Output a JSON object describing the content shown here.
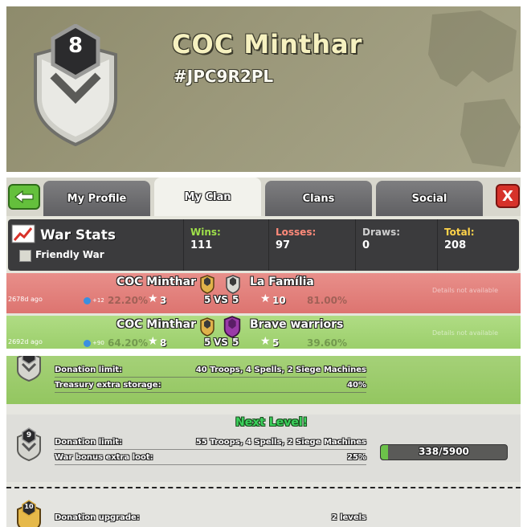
{
  "header": {
    "clan_level": "8",
    "clan_name": "COC Minthar",
    "clan_tag": "#JPC9R2PL"
  },
  "tabs": [
    "My Profile",
    "My Clan",
    "Clans",
    "Social"
  ],
  "active_tab": "My Clan",
  "close_label": "X",
  "war_stats": {
    "title": "War Stats",
    "friendly_war_label": "Friendly War",
    "wins_label": "Wins:",
    "wins": "111",
    "losses_label": "Losses:",
    "losses": "97",
    "draws_label": "Draws:",
    "draws": "0",
    "total_label": "Total:",
    "total": "208"
  },
  "war_log": [
    {
      "ago": "2678d ago",
      "our_name": "COC Minthar",
      "our_level": "8",
      "opponent": "La Família",
      "opponent_level": "9",
      "xp": "+12",
      "our_pct": "22.20%",
      "our_stars": "3",
      "our_size": "5",
      "vs": "VS",
      "opp_size": "5",
      "opp_stars": "10",
      "opp_pct": "81.00%",
      "details": "Details not available",
      "result": "loss"
    },
    {
      "ago": "2692d ago",
      "our_name": "COC Minthar",
      "our_level": "8",
      "opponent": "Brave warriors",
      "opponent_level": "8",
      "xp": "+90",
      "our_pct": "64.20%",
      "our_stars": "8",
      "our_size": "5",
      "vs": "VS",
      "opp_size": "5",
      "opp_stars": "5",
      "opp_pct": "39.60%",
      "details": "Details not available",
      "result": "win"
    }
  ],
  "perks": {
    "current_level": "8",
    "current": [
      {
        "label": "Donation limit:",
        "value": "40 Troops, 4 Spells, 2 Siege Machines"
      },
      {
        "label": "Treasury extra storage:",
        "value": "40%"
      }
    ],
    "next_level_title": "Next Level!",
    "next_level": "9",
    "next": [
      {
        "label": "Donation limit:",
        "value": "55 Troops, 4 Spells, 2 Siege Machines"
      },
      {
        "label": "War bonus extra loot:",
        "value": "25%"
      }
    ],
    "progress_text": "338/5900",
    "progress_fraction": 0.057,
    "level_10": "10",
    "level_10_lines": [
      {
        "label": "Donation upgrade:",
        "value": "2 levels"
      }
    ]
  },
  "colors": {
    "loss_row": "#dd7470",
    "win_row": "#97cc66",
    "next_level_green": "#3bd15c",
    "close_red": "#d6322a"
  }
}
